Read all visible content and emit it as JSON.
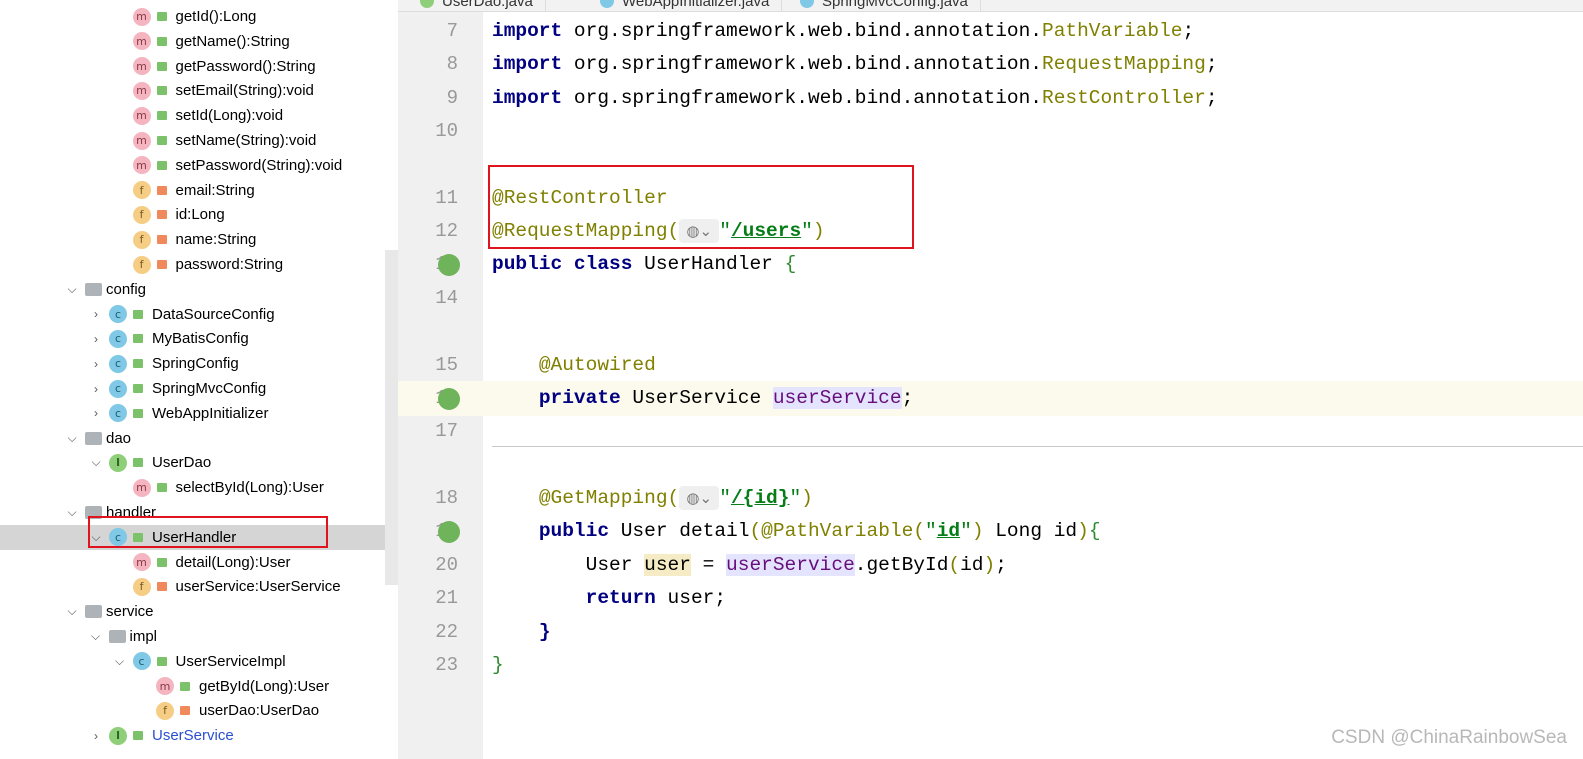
{
  "tabs": [
    {
      "label": "UserDao.java",
      "icon": "interface-icon"
    },
    {
      "label": "WebAppInitializer.java",
      "icon": "class-icon"
    },
    {
      "label": "SpringMvcConfig.java",
      "icon": "class-icon"
    }
  ],
  "tree": [
    {
      "label": "getId():Long",
      "kind": "m",
      "access": "pub",
      "level": 2
    },
    {
      "label": "getName():String",
      "kind": "m",
      "access": "pub",
      "level": 2
    },
    {
      "label": "getPassword():String",
      "kind": "m",
      "access": "pub",
      "level": 2
    },
    {
      "label": "setEmail(String):void",
      "kind": "m",
      "access": "pub",
      "level": 2
    },
    {
      "label": "setId(Long):void",
      "kind": "m",
      "access": "pub",
      "level": 2
    },
    {
      "label": "setName(String):void",
      "kind": "m",
      "access": "pub",
      "level": 2
    },
    {
      "label": "setPassword(String):void",
      "kind": "m",
      "access": "pub",
      "level": 2
    },
    {
      "label": "email:String",
      "kind": "f",
      "access": "priv",
      "level": 2
    },
    {
      "label": "id:Long",
      "kind": "f",
      "access": "priv",
      "level": 2
    },
    {
      "label": "name:String",
      "kind": "f",
      "access": "priv",
      "level": 2
    },
    {
      "label": "password:String",
      "kind": "f",
      "access": "priv",
      "level": 2
    },
    {
      "label": "config",
      "kind": "folder",
      "level": 0,
      "chevron": "open"
    },
    {
      "label": "DataSourceConfig",
      "kind": "c",
      "access": "pub",
      "level": 1,
      "chevron": "closed"
    },
    {
      "label": "MyBatisConfig",
      "kind": "c",
      "access": "pub",
      "level": 1,
      "chevron": "closed"
    },
    {
      "label": "SpringConfig",
      "kind": "c",
      "access": "pub",
      "level": 1,
      "chevron": "closed"
    },
    {
      "label": "SpringMvcConfig",
      "kind": "c",
      "access": "pub",
      "level": 1,
      "chevron": "closed"
    },
    {
      "label": "WebAppInitializer",
      "kind": "c",
      "access": "pub",
      "level": 1,
      "chevron": "closed"
    },
    {
      "label": "dao",
      "kind": "folder",
      "level": 0,
      "chevron": "open"
    },
    {
      "label": "UserDao",
      "kind": "i",
      "access": "pub",
      "level": 1,
      "chevron": "open"
    },
    {
      "label": "selectById(Long):User",
      "kind": "m",
      "access": "pub",
      "level": 2
    },
    {
      "label": "handler",
      "kind": "folder",
      "level": 0,
      "chevron": "open"
    },
    {
      "label": "UserHandler",
      "kind": "c",
      "access": "pub",
      "level": 1,
      "chevron": "open",
      "selected": true
    },
    {
      "label": "detail(Long):User",
      "kind": "m",
      "access": "pub",
      "level": 2
    },
    {
      "label": "userService:UserService",
      "kind": "f",
      "access": "priv",
      "level": 2
    },
    {
      "label": "service",
      "kind": "folder",
      "level": 0,
      "chevron": "open"
    },
    {
      "label": "impl",
      "kind": "folder",
      "level": 1,
      "chevron": "open"
    },
    {
      "label": "UserServiceImpl",
      "kind": "c",
      "access": "pub",
      "level": 2,
      "chevron": "open"
    },
    {
      "label": "getById(Long):User",
      "kind": "m",
      "access": "pub",
      "level": 3
    },
    {
      "label": "userDao:UserDao",
      "kind": "f",
      "access": "priv",
      "level": 3
    },
    {
      "label": "UserService",
      "kind": "i",
      "access": "pub",
      "level": 1,
      "chevron": "closed",
      "modified": true
    }
  ],
  "code": [
    {
      "n": "7",
      "tokens": [
        [
          "kw",
          "import"
        ],
        [
          "",
          "org.springframework.web.bind.annotation."
        ],
        [
          "ann",
          "PathVariable"
        ],
        [
          "",
          ";"
        ]
      ]
    },
    {
      "n": "8",
      "tokens": [
        [
          "kw",
          "import"
        ],
        [
          "",
          "org.springframework.web.bind.annotation."
        ],
        [
          "ann",
          "RequestMapping"
        ],
        [
          "",
          ";"
        ]
      ]
    },
    {
      "n": "9",
      "tokens": [
        [
          "kw",
          "import"
        ],
        [
          "",
          "org.springframework.web.bind.annotation."
        ],
        [
          "ann",
          "RestController"
        ],
        [
          "",
          ";"
        ]
      ]
    },
    {
      "n": "10",
      "tokens": []
    },
    {
      "n": "11",
      "tokens": [
        [
          "ann",
          "@RestController"
        ]
      ]
    },
    {
      "n": "12",
      "tokens": [
        [
          "ann",
          "@RequestMapping("
        ],
        [
          "globe",
          "◍⌄"
        ],
        [
          "str",
          "\""
        ],
        [
          "strb",
          "/users"
        ],
        [
          "str",
          "\""
        ],
        [
          "ann",
          ")"
        ]
      ]
    },
    {
      "n": "13",
      "tokens": [
        [
          "kw",
          "public class"
        ],
        [
          "",
          " UserHandler "
        ],
        [
          "br",
          "{"
        ]
      ],
      "gutter": "bean-icon"
    },
    {
      "n": "14",
      "tokens": []
    },
    {
      "n": "15",
      "tokens": [
        [
          "",
          "    "
        ],
        [
          "ann",
          "@Autowired"
        ]
      ]
    },
    {
      "n": "16",
      "tokens": [
        [
          "",
          "    "
        ],
        [
          "kw",
          "private"
        ],
        [
          "",
          " UserService "
        ],
        [
          "var",
          "userService"
        ],
        [
          "",
          ";"
        ]
      ],
      "gutter": "autowired-icon",
      "current": true
    },
    {
      "n": "17",
      "tokens": []
    },
    {
      "n": "18",
      "tokens": [
        [
          "",
          "    "
        ],
        [
          "ann",
          "@GetMapping("
        ],
        [
          "globe",
          "◍⌄"
        ],
        [
          "str",
          "\""
        ],
        [
          "strb",
          "/{id}"
        ],
        [
          "str",
          "\""
        ],
        [
          "ann",
          ")"
        ]
      ]
    },
    {
      "n": "19",
      "tokens": [
        [
          "",
          "    "
        ],
        [
          "kw",
          "public"
        ],
        [
          "",
          " User detail"
        ],
        [
          "ann",
          "(@PathVariable("
        ],
        [
          "str",
          "\""
        ],
        [
          "strb",
          "id"
        ],
        [
          "str",
          "\""
        ],
        [
          "ann",
          ")"
        ],
        [
          "",
          " Long id"
        ],
        [
          "ann",
          ")"
        ],
        [
          "br",
          "{"
        ]
      ],
      "gutter": "endpoint-icon"
    },
    {
      "n": "20",
      "tokens": [
        [
          "",
          "        User "
        ],
        [
          "uvar",
          "user"
        ],
        [
          "",
          " = "
        ],
        [
          "var",
          "userService"
        ],
        [
          "",
          ".getById"
        ],
        [
          "ann",
          "("
        ],
        [
          "",
          "id"
        ],
        [
          "ann",
          ")"
        ],
        [
          "",
          ";"
        ]
      ]
    },
    {
      "n": "21",
      "tokens": [
        [
          "",
          "        "
        ],
        [
          "kw",
          "return"
        ],
        [
          "",
          " user;"
        ]
      ]
    },
    {
      "n": "22",
      "tokens": [
        [
          "",
          "    "
        ],
        [
          "kw",
          "}"
        ]
      ]
    },
    {
      "n": "23",
      "tokens": [
        [
          "br",
          "}"
        ]
      ]
    }
  ],
  "watermark": "CSDN @ChinaRainbowSea"
}
